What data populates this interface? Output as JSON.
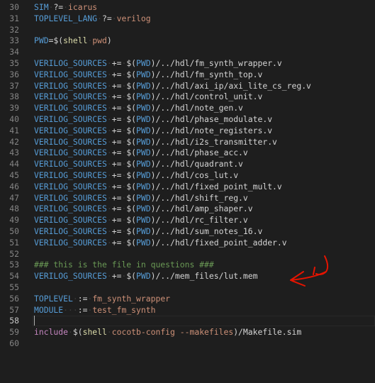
{
  "editor": {
    "colors": {
      "background": "#1e1e1e",
      "line_number": "#858585",
      "variable": "#569cd6",
      "string": "#ce9178",
      "function": "#dcdcaa",
      "comment": "#6a9955",
      "arrow": "#e51400"
    },
    "current_line": "58",
    "annotation_icon": "hand-drawn-arrow-icon",
    "lines": [
      {
        "n": "30",
        "tokens": [
          {
            "t": "SIM",
            "c": "var"
          },
          {
            "t": " ",
            "c": "ws"
          },
          {
            "t": "?=",
            "c": "op"
          },
          {
            "t": " ",
            "c": "ws"
          },
          {
            "t": "icarus",
            "c": "str"
          }
        ]
      },
      {
        "n": "31",
        "tokens": [
          {
            "t": "TOPLEVEL_LANG",
            "c": "var"
          },
          {
            "t": " ",
            "c": "ws"
          },
          {
            "t": "?=",
            "c": "op"
          },
          {
            "t": " ",
            "c": "ws"
          },
          {
            "t": "verilog",
            "c": "str"
          }
        ]
      },
      {
        "n": "32",
        "tokens": []
      },
      {
        "n": "33",
        "tokens": [
          {
            "t": "PWD",
            "c": "var"
          },
          {
            "t": "=",
            "c": "op"
          },
          {
            "t": "$(",
            "c": "txt"
          },
          {
            "t": "shell",
            "c": "fn"
          },
          {
            "t": " ",
            "c": "ws"
          },
          {
            "t": "pwd",
            "c": "str"
          },
          {
            "t": ")",
            "c": "txt"
          }
        ]
      },
      {
        "n": "34",
        "tokens": []
      },
      {
        "n": "35",
        "tokens": [
          {
            "t": "VERILOG_SOURCES",
            "c": "var"
          },
          {
            "t": " ",
            "c": "ws"
          },
          {
            "t": "+=",
            "c": "op"
          },
          {
            "t": " ",
            "c": "ws"
          },
          {
            "t": "$(",
            "c": "txt"
          },
          {
            "t": "PWD",
            "c": "var"
          },
          {
            "t": ")/../hdl/fm_synth_wrapper.v",
            "c": "txt"
          }
        ]
      },
      {
        "n": "36",
        "tokens": [
          {
            "t": "VERILOG_SOURCES",
            "c": "var"
          },
          {
            "t": " ",
            "c": "ws"
          },
          {
            "t": "+=",
            "c": "op"
          },
          {
            "t": " ",
            "c": "ws"
          },
          {
            "t": "$(",
            "c": "txt"
          },
          {
            "t": "PWD",
            "c": "var"
          },
          {
            "t": ")/../hdl/fm_synth_top.v",
            "c": "txt"
          }
        ]
      },
      {
        "n": "37",
        "tokens": [
          {
            "t": "VERILOG_SOURCES",
            "c": "var"
          },
          {
            "t": " ",
            "c": "ws"
          },
          {
            "t": "+=",
            "c": "op"
          },
          {
            "t": " ",
            "c": "ws"
          },
          {
            "t": "$(",
            "c": "txt"
          },
          {
            "t": "PWD",
            "c": "var"
          },
          {
            "t": ")/../hdl/axi_ip/axi_lite_cs_reg.v",
            "c": "txt"
          }
        ]
      },
      {
        "n": "38",
        "tokens": [
          {
            "t": "VERILOG_SOURCES",
            "c": "var"
          },
          {
            "t": " ",
            "c": "ws"
          },
          {
            "t": "+=",
            "c": "op"
          },
          {
            "t": " ",
            "c": "ws"
          },
          {
            "t": "$(",
            "c": "txt"
          },
          {
            "t": "PWD",
            "c": "var"
          },
          {
            "t": ")/../hdl/control_unit.v",
            "c": "txt"
          }
        ]
      },
      {
        "n": "39",
        "tokens": [
          {
            "t": "VERILOG_SOURCES",
            "c": "var"
          },
          {
            "t": " ",
            "c": "ws"
          },
          {
            "t": "+=",
            "c": "op"
          },
          {
            "t": " ",
            "c": "ws"
          },
          {
            "t": "$(",
            "c": "txt"
          },
          {
            "t": "PWD",
            "c": "var"
          },
          {
            "t": ")/../hdl/note_gen.v",
            "c": "txt"
          }
        ]
      },
      {
        "n": "40",
        "tokens": [
          {
            "t": "VERILOG_SOURCES",
            "c": "var"
          },
          {
            "t": " ",
            "c": "ws"
          },
          {
            "t": "+=",
            "c": "op"
          },
          {
            "t": " ",
            "c": "ws"
          },
          {
            "t": "$(",
            "c": "txt"
          },
          {
            "t": "PWD",
            "c": "var"
          },
          {
            "t": ")/../hdl/phase_modulate.v",
            "c": "txt"
          }
        ]
      },
      {
        "n": "41",
        "tokens": [
          {
            "t": "VERILOG_SOURCES",
            "c": "var"
          },
          {
            "t": " ",
            "c": "ws"
          },
          {
            "t": "+=",
            "c": "op"
          },
          {
            "t": " ",
            "c": "ws"
          },
          {
            "t": "$(",
            "c": "txt"
          },
          {
            "t": "PWD",
            "c": "var"
          },
          {
            "t": ")/../hdl/note_registers.v",
            "c": "txt"
          }
        ]
      },
      {
        "n": "42",
        "tokens": [
          {
            "t": "VERILOG_SOURCES",
            "c": "var"
          },
          {
            "t": " ",
            "c": "ws"
          },
          {
            "t": "+=",
            "c": "op"
          },
          {
            "t": " ",
            "c": "ws"
          },
          {
            "t": "$(",
            "c": "txt"
          },
          {
            "t": "PWD",
            "c": "var"
          },
          {
            "t": ")/../hdl/i2s_transmitter.v",
            "c": "txt"
          }
        ]
      },
      {
        "n": "43",
        "tokens": [
          {
            "t": "VERILOG_SOURCES",
            "c": "var"
          },
          {
            "t": " ",
            "c": "ws"
          },
          {
            "t": "+=",
            "c": "op"
          },
          {
            "t": " ",
            "c": "ws"
          },
          {
            "t": "$(",
            "c": "txt"
          },
          {
            "t": "PWD",
            "c": "var"
          },
          {
            "t": ")/../hdl/phase_acc.v",
            "c": "txt"
          }
        ]
      },
      {
        "n": "44",
        "tokens": [
          {
            "t": "VERILOG_SOURCES",
            "c": "var"
          },
          {
            "t": " ",
            "c": "ws"
          },
          {
            "t": "+=",
            "c": "op"
          },
          {
            "t": " ",
            "c": "ws"
          },
          {
            "t": "$(",
            "c": "txt"
          },
          {
            "t": "PWD",
            "c": "var"
          },
          {
            "t": ")/../hdl/quadrant.v",
            "c": "txt"
          }
        ]
      },
      {
        "n": "45",
        "tokens": [
          {
            "t": "VERILOG_SOURCES",
            "c": "var"
          },
          {
            "t": " ",
            "c": "ws"
          },
          {
            "t": "+=",
            "c": "op"
          },
          {
            "t": " ",
            "c": "ws"
          },
          {
            "t": "$(",
            "c": "txt"
          },
          {
            "t": "PWD",
            "c": "var"
          },
          {
            "t": ")/../hdl/cos_lut.v",
            "c": "txt"
          }
        ]
      },
      {
        "n": "46",
        "tokens": [
          {
            "t": "VERILOG_SOURCES",
            "c": "var"
          },
          {
            "t": " ",
            "c": "ws"
          },
          {
            "t": "+=",
            "c": "op"
          },
          {
            "t": " ",
            "c": "ws"
          },
          {
            "t": "$(",
            "c": "txt"
          },
          {
            "t": "PWD",
            "c": "var"
          },
          {
            "t": ")/../hdl/fixed_point_mult.v",
            "c": "txt"
          }
        ]
      },
      {
        "n": "47",
        "tokens": [
          {
            "t": "VERILOG_SOURCES",
            "c": "var"
          },
          {
            "t": " ",
            "c": "ws"
          },
          {
            "t": "+=",
            "c": "op"
          },
          {
            "t": " ",
            "c": "ws"
          },
          {
            "t": "$(",
            "c": "txt"
          },
          {
            "t": "PWD",
            "c": "var"
          },
          {
            "t": ")/../hdl/shift_reg.v",
            "c": "txt"
          }
        ]
      },
      {
        "n": "48",
        "tokens": [
          {
            "t": "VERILOG_SOURCES",
            "c": "var"
          },
          {
            "t": " ",
            "c": "ws"
          },
          {
            "t": "+=",
            "c": "op"
          },
          {
            "t": " ",
            "c": "ws"
          },
          {
            "t": "$(",
            "c": "txt"
          },
          {
            "t": "PWD",
            "c": "var"
          },
          {
            "t": ")/../hdl/amp_shaper.v",
            "c": "txt"
          }
        ]
      },
      {
        "n": "49",
        "tokens": [
          {
            "t": "VERILOG_SOURCES",
            "c": "var"
          },
          {
            "t": " ",
            "c": "ws"
          },
          {
            "t": "+=",
            "c": "op"
          },
          {
            "t": " ",
            "c": "ws"
          },
          {
            "t": "$(",
            "c": "txt"
          },
          {
            "t": "PWD",
            "c": "var"
          },
          {
            "t": ")/../hdl/rc_filter.v",
            "c": "txt"
          }
        ]
      },
      {
        "n": "50",
        "tokens": [
          {
            "t": "VERILOG_SOURCES",
            "c": "var"
          },
          {
            "t": " ",
            "c": "ws"
          },
          {
            "t": "+=",
            "c": "op"
          },
          {
            "t": " ",
            "c": "ws"
          },
          {
            "t": "$(",
            "c": "txt"
          },
          {
            "t": "PWD",
            "c": "var"
          },
          {
            "t": ")/../hdl/sum_notes_16.v",
            "c": "txt"
          }
        ]
      },
      {
        "n": "51",
        "tokens": [
          {
            "t": "VERILOG_SOURCES",
            "c": "var"
          },
          {
            "t": " ",
            "c": "ws"
          },
          {
            "t": "+=",
            "c": "op"
          },
          {
            "t": " ",
            "c": "ws"
          },
          {
            "t": "$(",
            "c": "txt"
          },
          {
            "t": "PWD",
            "c": "var"
          },
          {
            "t": ")/../hdl/fixed_point_adder.v",
            "c": "txt"
          }
        ]
      },
      {
        "n": "52",
        "tokens": []
      },
      {
        "n": "53",
        "tokens": [
          {
            "t": "### this is the file in questions ###",
            "c": "cm"
          }
        ]
      },
      {
        "n": "54",
        "tokens": [
          {
            "t": "VERILOG_SOURCES",
            "c": "var"
          },
          {
            "t": " ",
            "c": "ws"
          },
          {
            "t": "+=",
            "c": "op"
          },
          {
            "t": " ",
            "c": "ws"
          },
          {
            "t": "$(",
            "c": "txt"
          },
          {
            "t": "PWD",
            "c": "var"
          },
          {
            "t": ")/../mem_files/lut.mem",
            "c": "txt"
          }
        ]
      },
      {
        "n": "55",
        "tokens": []
      },
      {
        "n": "56",
        "tokens": [
          {
            "t": "TOPLEVEL",
            "c": "var"
          },
          {
            "t": " ",
            "c": "ws"
          },
          {
            "t": ":=",
            "c": "op"
          },
          {
            "t": " ",
            "c": "ws"
          },
          {
            "t": "fm_synth_wrapper",
            "c": "str"
          }
        ]
      },
      {
        "n": "57",
        "tokens": [
          {
            "t": "MODULE",
            "c": "var"
          },
          {
            "t": "   ",
            "c": "ws"
          },
          {
            "t": ":=",
            "c": "op"
          },
          {
            "t": " ",
            "c": "ws"
          },
          {
            "t": "test_fm_synth",
            "c": "str"
          }
        ]
      },
      {
        "n": "58",
        "tokens": []
      },
      {
        "n": "59",
        "tokens": [
          {
            "t": "include",
            "c": "kw"
          },
          {
            "t": " ",
            "c": "ws"
          },
          {
            "t": "$(",
            "c": "txt"
          },
          {
            "t": "shell",
            "c": "fn"
          },
          {
            "t": " ",
            "c": "ws"
          },
          {
            "t": "cocotb-config --makefiles",
            "c": "str"
          },
          {
            "t": ")/Makefile.sim",
            "c": "txt"
          }
        ]
      },
      {
        "n": "60",
        "tokens": []
      }
    ]
  }
}
